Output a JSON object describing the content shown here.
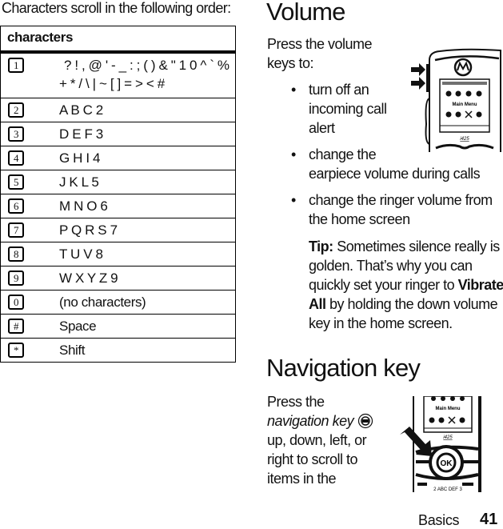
{
  "intro": "Characters scroll in the following order:",
  "table": {
    "header": "characters",
    "rows": [
      {
        "key": "1",
        "chars_line1": "? ! , @ ' - _ : ; ( ) & \" 1 0 ^ ` %",
        "chars_line2": "+ * / \\ | ~ [ ] = > < #"
      },
      {
        "key": "2",
        "chars": "A B C 2"
      },
      {
        "key": "3",
        "chars": "D E F 3"
      },
      {
        "key": "4",
        "chars": "G H I 4"
      },
      {
        "key": "5",
        "chars": "J K L 5"
      },
      {
        "key": "6",
        "chars": "M N O 6"
      },
      {
        "key": "7",
        "chars": "P Q R S 7"
      },
      {
        "key": "8",
        "chars": "T U V 8"
      },
      {
        "key": "9",
        "chars": "W X Y Z 9"
      },
      {
        "key": "0",
        "chars": "(no characters)"
      },
      {
        "key": "#",
        "chars": "Space"
      },
      {
        "key": "*",
        "chars": "Shift"
      }
    ]
  },
  "volume": {
    "title": "Volume",
    "lead_line1": "Press the volume",
    "lead_line2": "keys to:",
    "bullets": [
      {
        "lines": [
          "turn off an",
          "incoming call",
          "alert"
        ]
      },
      {
        "lines": [
          "change the",
          "earpiece volume during calls"
        ]
      },
      {
        "lines": [
          "change the ringer volume from",
          "the home screen"
        ]
      }
    ],
    "tip": {
      "label": "Tip:",
      "line1": "Sometimes silence really is",
      "line2": "golden. That’s why you can",
      "line3_pre": "quickly set your ringer to",
      "line3_bold": "Vibrate",
      "line4_bold": "All",
      "line4_post": "by holding the down volume",
      "line5": "key in the home screen."
    },
    "phone_image": {
      "screen_title": "Main Menu",
      "model": "i425",
      "logo": "motorola-logo"
    }
  },
  "navigation": {
    "title": "Navigation key",
    "line1": "Press the",
    "line2_italic": "navigation key",
    "line3": "up, down, left, or",
    "line4": "right to scroll to",
    "line5": "items in the",
    "phone_image": {
      "screen_title": "Main Menu",
      "model": "i425",
      "center_key": "OK"
    }
  },
  "footer": {
    "section": "Basics",
    "page": "41"
  }
}
